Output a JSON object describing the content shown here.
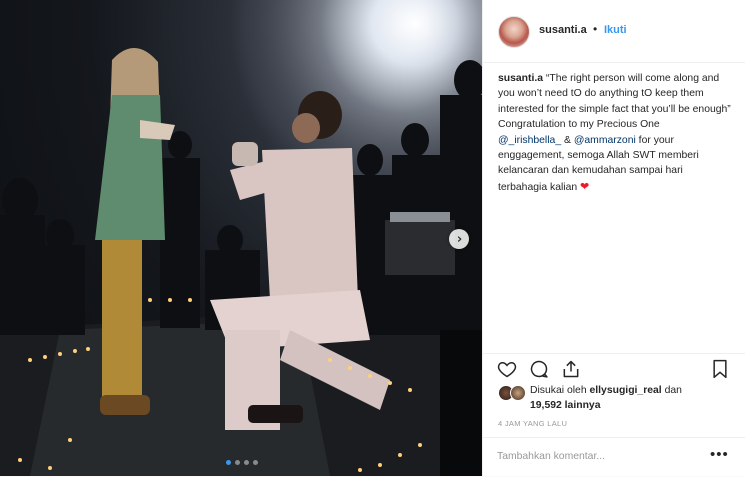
{
  "post": {
    "username": "susanti.a",
    "follow_label": "Ikuti",
    "separator": "•",
    "caption": {
      "username": "susanti.a",
      "text_1": " “The right person will come along and you won’t need tO do anything tO keep them interested for the simple fact that you’ll be enough”",
      "text_2": "Congratulation to my Precious One",
      "mention_1": "@_irishbella_",
      "amp": " & ",
      "mention_2": "@ammarzoni",
      "text_3": " for your enggagement, semoga Allah SWT memberi kelancaran dan kemudahan sampai hari terbahagia kalian ",
      "heart": "❤"
    },
    "likes": {
      "prefix": "Disukai oleh ",
      "user": "ellysugigi_real",
      "middle": " dan",
      "count": "19,592",
      "suffix": " lainnya"
    },
    "time": "4 JAM YANG LALU",
    "comment_placeholder": "Tambahkan komentar...",
    "more_label": "•••",
    "carousel": {
      "next_arrow": "›",
      "total_slides": 4,
      "active_slide": 1
    },
    "icons": [
      "heart-icon",
      "comment-icon",
      "share-icon",
      "bookmark-icon"
    ],
    "colors": {
      "link": "#3897f0",
      "mention": "#003569",
      "heart": "#ed1c24",
      "muted": "#999999"
    }
  }
}
